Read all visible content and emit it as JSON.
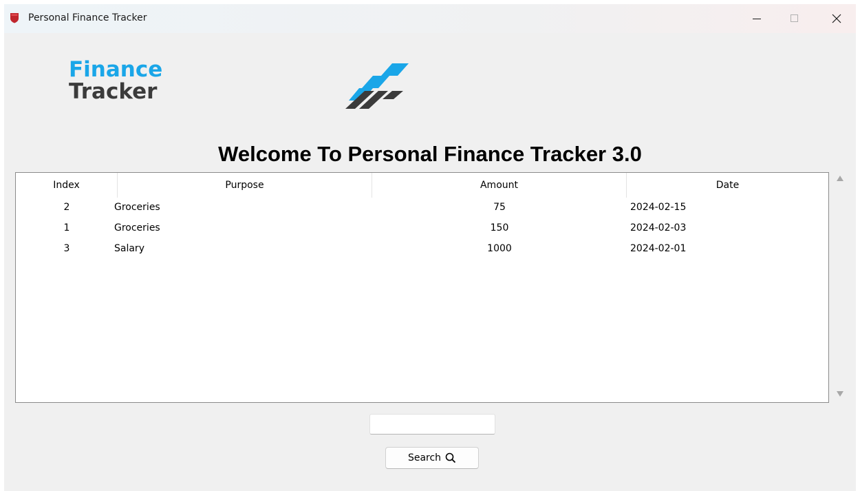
{
  "window": {
    "title": "Personal Finance Tracker",
    "icon": "shield-icon"
  },
  "titlebar_controls": {
    "minimize_icon": "minimize-icon",
    "maximize_icon": "maximize-icon",
    "close_icon": "close-icon"
  },
  "logo": {
    "line1": "Finance",
    "line2": "Tracker",
    "accent_color": "#1aa6e8",
    "dark_color": "#3b3b3b"
  },
  "welcome_text": "Welcome To Personal Finance Tracker 3.0",
  "table": {
    "columns": [
      "Index",
      "Purpose",
      "Amount",
      "Date"
    ],
    "rows": [
      {
        "index": "2",
        "purpose": "Groceries",
        "amount": "75",
        "date": "2024-02-15"
      },
      {
        "index": "1",
        "purpose": "Groceries",
        "amount": "150",
        "date": "2024-02-03"
      },
      {
        "index": "3",
        "purpose": "Salary",
        "amount": "1000",
        "date": "2024-02-01"
      }
    ]
  },
  "search": {
    "value": "",
    "button_label": "Search",
    "button_icon": "search-icon"
  }
}
